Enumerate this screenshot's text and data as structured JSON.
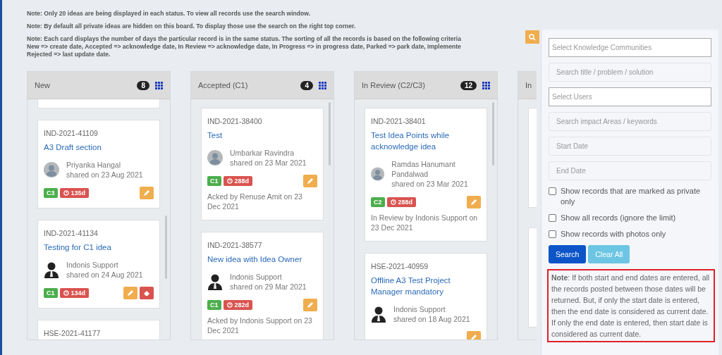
{
  "notes": [
    "Note: Only 20 ideas are being displayed in each status. To view all records use the search window.",
    "Note: By default all private ideas are hidden on this board. To display those use the search on the right top corner.",
    "Note: Each card displays the number of days the particular record is in the same status. The sorting of all the records is based on the following criteria",
    "New => create date, Accepted => acknowledge date, In Review => acknowledge date, In Progress => in progress date, Parked => park date, Implemente",
    "Rejected => last update date."
  ],
  "columns": [
    {
      "title": "New",
      "count": "8",
      "cards": [
        {
          "kind": "stub"
        },
        {
          "kind": "card",
          "id": "IND-2021-41109",
          "title": "A3 Draft section",
          "avatar": {
            "kind": "default"
          },
          "author": "Priyanka Hangal",
          "shared": "shared on 23 Aug 2021",
          "category": "C3",
          "days": "135d",
          "actions": [
            {
              "kind": "edit"
            }
          ]
        },
        {
          "kind": "card",
          "id": "IND-2021-41134",
          "title": "Testing for C1 idea",
          "avatar": {
            "kind": "dark"
          },
          "author": "Indonis Support",
          "shared": "shared on 24 Aug 2021",
          "category": "C1",
          "days": "134d",
          "actions": [
            {
              "kind": "edit"
            },
            {
              "kind": "erase"
            }
          ]
        },
        {
          "kind": "card",
          "id": "HSE-2021-41177"
        }
      ]
    },
    {
      "title": "Accepted (C1)",
      "count": "4",
      "cards": [
        {
          "kind": "card",
          "id": "IND-2021-38400",
          "title": "Test",
          "avatar": {
            "kind": "default"
          },
          "author": "Umbarkar Ravindra",
          "shared": "shared on 23 Mar 2021",
          "category": "C1",
          "days": "288d",
          "actions": [
            {
              "kind": "edit"
            }
          ],
          "status": "Acked by Renuse Amit on 23 Dec 2021"
        },
        {
          "kind": "card",
          "id": "IND-2021-38577",
          "title": "New idea with Idea Owner",
          "avatar": {
            "kind": "dark"
          },
          "author": "Indonis Support",
          "shared": "shared on 29 Mar 2021",
          "category": "C1",
          "days": "282d",
          "actions": [
            {
              "kind": "edit"
            }
          ],
          "status": "Acked by Indonis Support on 23 Dec 2021"
        }
      ]
    },
    {
      "title": "In Review (C2/C3)",
      "count": "12",
      "cards": [
        {
          "kind": "card",
          "id": "IND-2021-38401",
          "title": "Test Idea Points while acknowledge idea",
          "avatar": {
            "kind": "default"
          },
          "author": "Ramdas Hanumant Pandalwad",
          "shared": "shared on 23 Mar 2021",
          "category": "C2",
          "days": "288d",
          "actions": [
            {
              "kind": "edit"
            }
          ],
          "status": "In Review by Indonis Support on 23 Dec 2021"
        },
        {
          "kind": "card",
          "id": "HSE-2021-40959",
          "title": "Offline A3 Test Project Manager mandatory",
          "avatar": {
            "kind": "dark"
          },
          "author": "Indonis Support",
          "shared": "shared on 18 Aug 2021",
          "actions": [
            {
              "kind": "edit"
            }
          ]
        }
      ]
    },
    {
      "title": "In",
      "cards": [
        {
          "kind": "blank"
        },
        {
          "kind": "blank"
        }
      ]
    }
  ],
  "search_panel": {
    "fields": [
      {
        "kind": "select",
        "placeholder": "Select Knowledge Communities"
      },
      {
        "kind": "text",
        "placeholder": "Search title / problem / solution"
      },
      {
        "kind": "select",
        "placeholder": "Select Users"
      },
      {
        "kind": "text",
        "placeholder": "Search impact Areas / keywords"
      },
      {
        "kind": "text",
        "placeholder": "Start Date"
      },
      {
        "kind": "text",
        "placeholder": "End Date"
      }
    ],
    "options": [
      {
        "label": "Show records that are marked as private only",
        "checked": false
      },
      {
        "label": "Show all records (ignore the limit)",
        "checked": false
      },
      {
        "label": "Show records with photos only",
        "checked": false
      }
    ],
    "buttons": [
      "Search",
      "Clear All"
    ],
    "note": "**Note**:  If both start and end dates are entered, all the records posted between those dates will be returned. But, if only the start date is entered, then the end date is considered as current date. If only the end date is entered, then start date is considered as current date."
  }
}
